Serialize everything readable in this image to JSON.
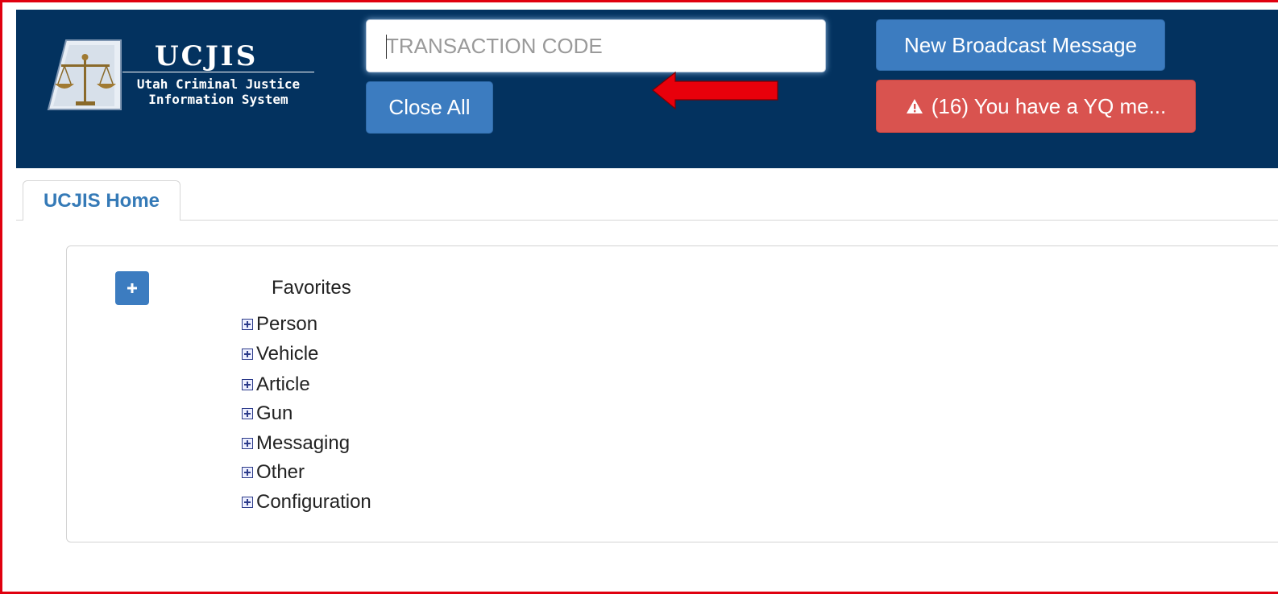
{
  "header": {
    "logo": {
      "title": "UCJIS",
      "subtitle_line1": "Utah Criminal Justice",
      "subtitle_line2": "Information System"
    },
    "transaction_input": {
      "placeholder": "TRANSACTION CODE",
      "value": ""
    },
    "close_all_label": "Close All",
    "broadcast_label": "New Broadcast Message",
    "alert_label": "(16) You have a YQ me...",
    "alert_icon": "warning-triangle-icon"
  },
  "tabs": [
    {
      "label": "UCJIS Home",
      "active": true
    }
  ],
  "favorites": {
    "title": "Favorites",
    "add_icon": "plus-icon",
    "items": [
      {
        "label": "Person"
      },
      {
        "label": "Vehicle"
      },
      {
        "label": "Article"
      },
      {
        "label": "Gun"
      },
      {
        "label": "Messaging"
      },
      {
        "label": "Other"
      },
      {
        "label": "Configuration"
      }
    ]
  },
  "colors": {
    "header_bg": "#03325f",
    "primary_button": "#3c7cc0",
    "danger_button": "#d9534f",
    "tab_text": "#357ab7",
    "annotation_arrow": "#e8000b",
    "frame_border": "#e0000f"
  }
}
